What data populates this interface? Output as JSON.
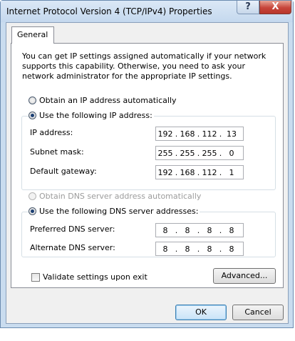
{
  "window": {
    "title": "Internet Protocol Version 4 (TCP/IPv4) Properties",
    "help_label": "?",
    "close_label": "X"
  },
  "tabs": [
    {
      "label": "General",
      "active": true
    }
  ],
  "general": {
    "description": "You can get IP settings assigned automatically if your network supports this capability. Otherwise, you need to ask your network administrator for the appropriate IP settings.",
    "ip_auto_label": "Obtain an IP address automatically",
    "ip_manual_label": "Use the following IP address:",
    "ip_mode": "manual",
    "ip_fields": [
      {
        "label": "IP address:",
        "octets": [
          "192",
          "168",
          "112",
          "13"
        ]
      },
      {
        "label": "Subnet mask:",
        "octets": [
          "255",
          "255",
          "255",
          "0"
        ]
      },
      {
        "label": "Default gateway:",
        "octets": [
          "192",
          "168",
          "112",
          "1"
        ]
      }
    ],
    "dns_auto_label": "Obtain DNS server address automatically",
    "dns_manual_label": "Use the following DNS server addresses:",
    "dns_mode": "manual",
    "dns_fields": [
      {
        "label": "Preferred DNS server:",
        "octets": [
          "8",
          "8",
          "8",
          "8"
        ]
      },
      {
        "label": "Alternate DNS server:",
        "octets": [
          "8",
          "8",
          "8",
          "8"
        ]
      }
    ],
    "validate_label": "Validate settings upon exit",
    "validate_checked": false,
    "advanced_label": "Advanced..."
  },
  "footer": {
    "ok_label": "OK",
    "cancel_label": "Cancel"
  }
}
